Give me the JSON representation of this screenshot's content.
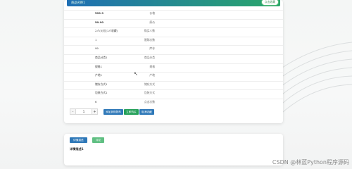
{
  "header": {
    "title": "商品名称1",
    "action_label": "点击收藏"
  },
  "details": [
    {
      "label": "价格",
      "value": "¥99.9",
      "strong": true
    },
    {
      "label": "原价",
      "value": "¥9.90",
      "strong": true
    },
    {
      "label": "购买人数",
      "value": "2人(0)位(1人收藏)",
      "strong": false
    },
    {
      "label": "限购次数",
      "value": "1",
      "strong": false
    },
    {
      "label": "库存",
      "value": "99",
      "strong": false
    },
    {
      "label": "商品分类",
      "value": "商品分类1",
      "strong": false
    },
    {
      "label": "规格",
      "value": "规格1",
      "strong": false
    },
    {
      "label": "产地",
      "value": "产地1",
      "strong": false
    },
    {
      "label": "储存方式",
      "value": "储存方式1",
      "strong": false
    },
    {
      "label": "包装方式",
      "value": "包装方式1",
      "strong": false
    },
    {
      "label": "点击次数",
      "value": "6",
      "strong": false
    }
  ],
  "quantity": {
    "minus": "-",
    "value": "1",
    "plus": "+"
  },
  "actions": {
    "add_to_cart": "添加到购物车",
    "buy_now": "立即购买",
    "favorite": "取消收藏"
  },
  "tabs": {
    "detail": "详情描述",
    "comment": "评论"
  },
  "detail_title": "详情描述1",
  "watermark": "CSDN @林蓝Python程序源码",
  "colors": {
    "header_start": "#1f6fb4",
    "header_end": "#2aa66a",
    "button_blue": "#2e78b8",
    "button_green": "#25a05a"
  }
}
